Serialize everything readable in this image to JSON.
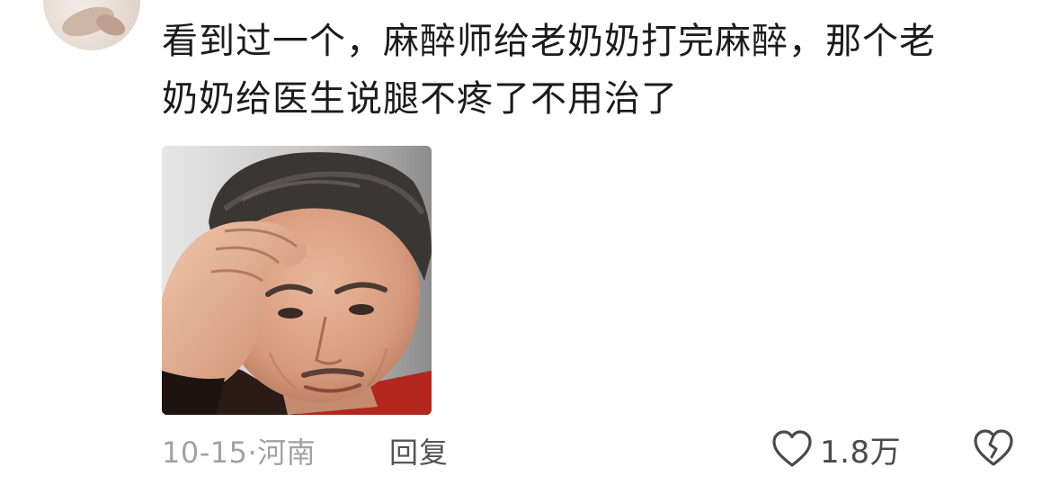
{
  "comment": {
    "line1": "看到过一个，麻醉师给老奶奶打完麻醉，那个老",
    "line2": "奶奶给医生说腿不疼了不用治了"
  },
  "meta": {
    "date": "10-15",
    "separator": "·",
    "location": "河南"
  },
  "actions": {
    "reply_label": "回复",
    "like_count": "1.8万",
    "like_icon": "heart-outline-icon",
    "dislike_icon": "broken-heart-icon"
  },
  "colors": {
    "text": "#1b1b1b",
    "meta": "#a2a2a2",
    "reply": "#545454",
    "icon": "#4a4a4a"
  }
}
